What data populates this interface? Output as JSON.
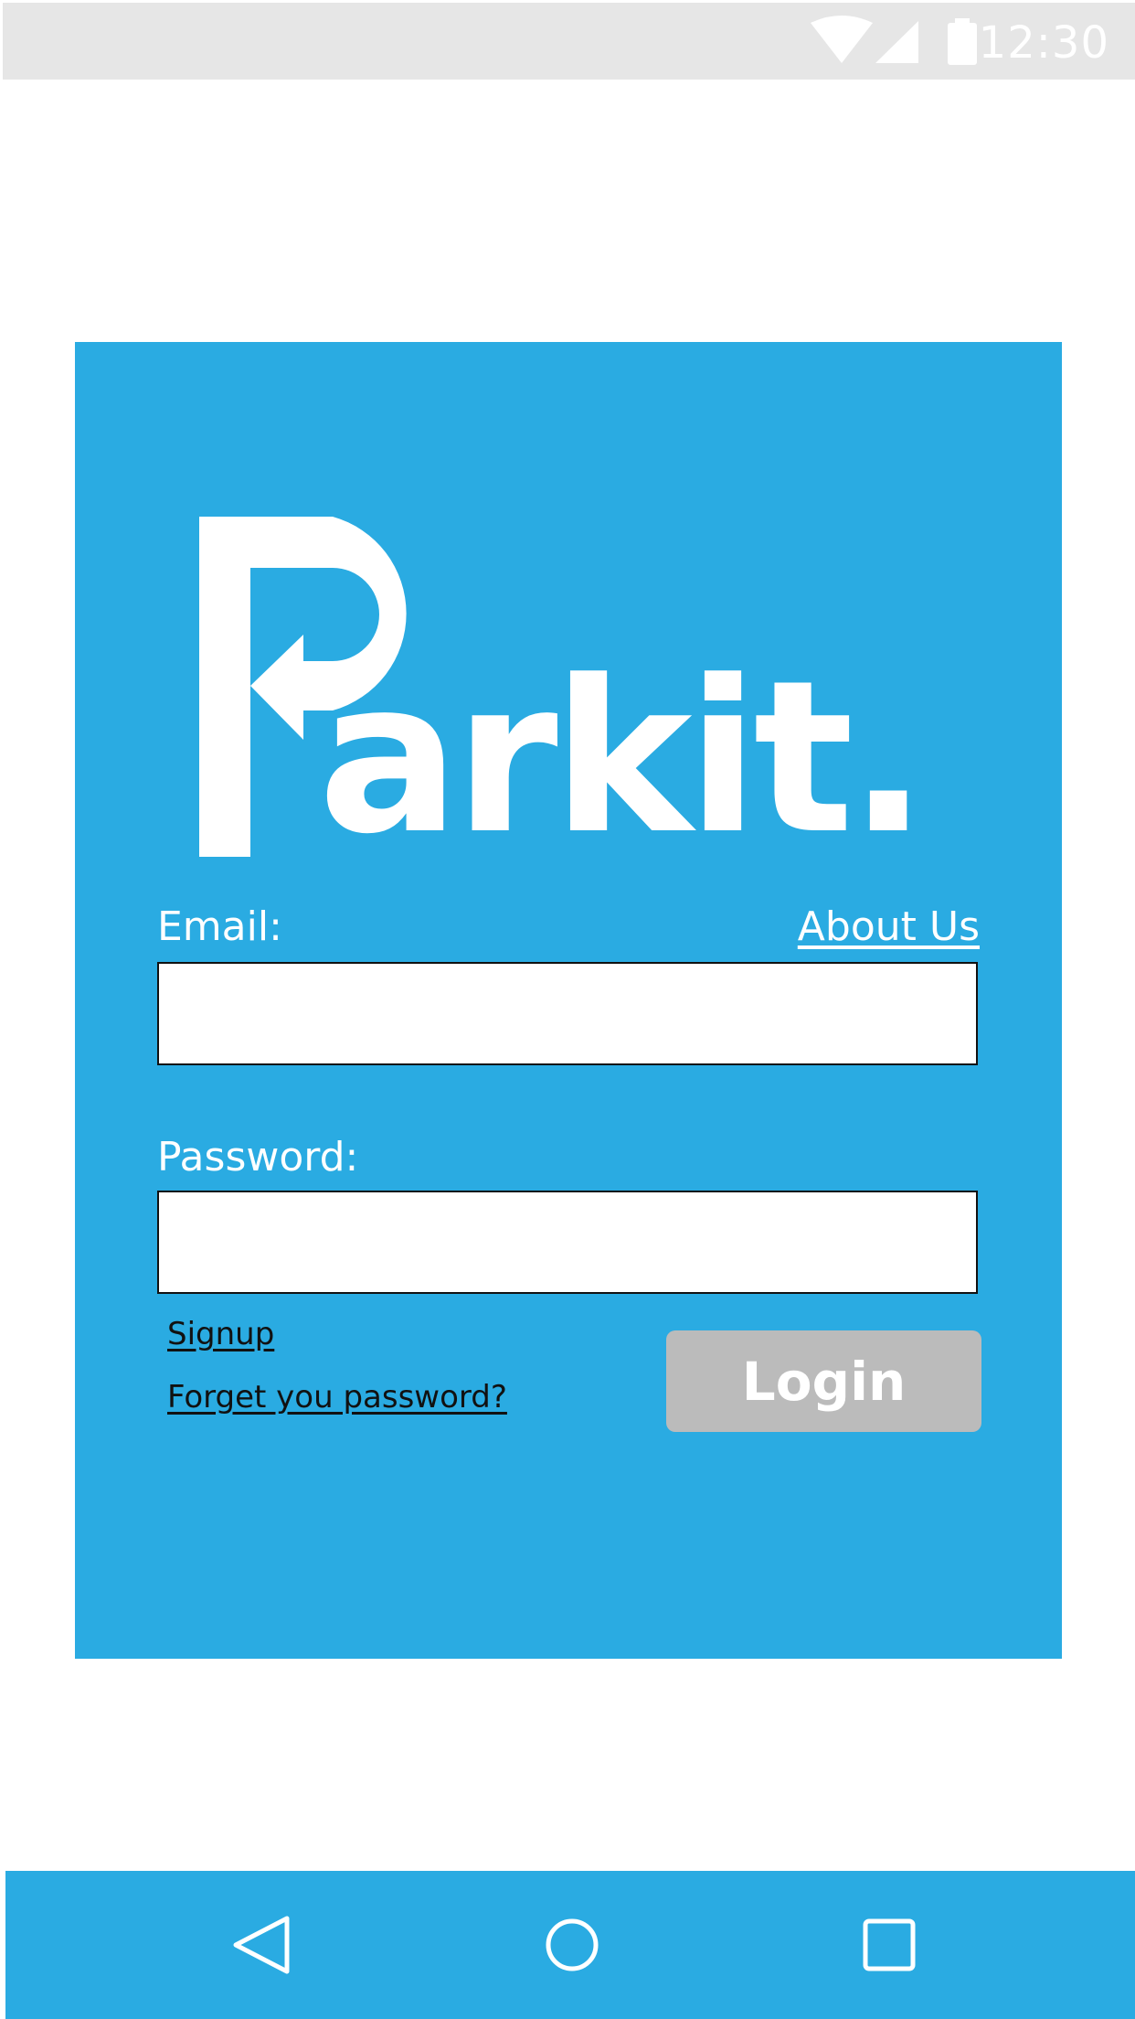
{
  "status_bar": {
    "time": "12:30",
    "icons": [
      "wifi-icon",
      "signal-icon",
      "battery-icon"
    ]
  },
  "brand": {
    "logo_text": "arkit.",
    "logo_letter": "P"
  },
  "form": {
    "email_label": "Email:",
    "about_us_link": "About Us",
    "email_value": "",
    "password_label": "Password:",
    "password_value": "",
    "signup_link": "Signup",
    "forgot_link": "Forget you password?",
    "login_button": "Login"
  },
  "nav_bar": {
    "buttons": [
      "back-icon",
      "home-icon",
      "recents-icon"
    ]
  },
  "colors": {
    "primary": "#2aabe2",
    "status_bar": "#e6e6e6",
    "button_disabled": "#bbbbbb"
  }
}
